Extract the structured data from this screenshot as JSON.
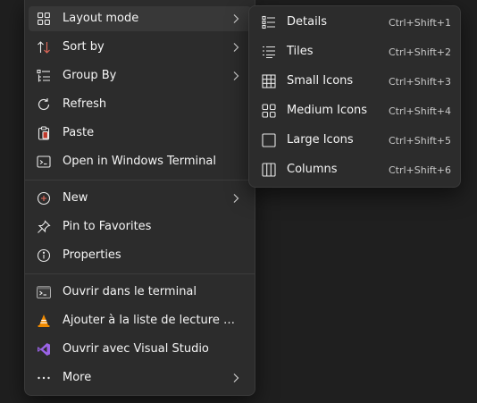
{
  "context_menu": {
    "items": [
      {
        "label": "Layout mode",
        "icon": "layout-grid-icon"
      },
      {
        "label": "Sort by",
        "icon": "sort-arrows-icon"
      },
      {
        "label": "Group By",
        "icon": "group-list-icon"
      },
      {
        "label": "Refresh",
        "icon": "refresh-icon"
      },
      {
        "label": "Paste",
        "icon": "clipboard-icon"
      },
      {
        "label": "Open in Windows Terminal",
        "icon": "terminal-icon"
      },
      {
        "label": "New",
        "icon": "plus-circle-icon"
      },
      {
        "label": "Pin to Favorites",
        "icon": "pin-icon"
      },
      {
        "label": "Properties",
        "icon": "info-icon"
      },
      {
        "label": "Ouvrir dans le terminal",
        "icon": "terminal-app-icon"
      },
      {
        "label": "Ajouter à la liste de lecture de...",
        "icon": "vlc-cone-icon"
      },
      {
        "label": "Ouvrir avec Visual Studio",
        "icon": "visual-studio-icon"
      },
      {
        "label": "More",
        "icon": "more-dots-icon"
      }
    ]
  },
  "layout_submenu": {
    "items": [
      {
        "label": "Details",
        "shortcut": "Ctrl+Shift+1",
        "icon": "details-list-icon"
      },
      {
        "label": "Tiles",
        "shortcut": "Ctrl+Shift+2",
        "icon": "tiles-list-icon"
      },
      {
        "label": "Small Icons",
        "shortcut": "Ctrl+Shift+3",
        "icon": "small-icons-grid-icon"
      },
      {
        "label": "Medium Icons",
        "shortcut": "Ctrl+Shift+4",
        "icon": "medium-icons-grid-icon"
      },
      {
        "label": "Large Icons",
        "shortcut": "Ctrl+Shift+5",
        "icon": "large-icon-square-icon"
      },
      {
        "label": "Columns",
        "shortcut": "Ctrl+Shift+6",
        "icon": "columns-icon"
      }
    ]
  },
  "colors": {
    "menu_bg": "#2c2c2c",
    "hover_bg": "#383838",
    "vlc_orange": "#f08a00",
    "vs_purple": "#9a63e6"
  }
}
